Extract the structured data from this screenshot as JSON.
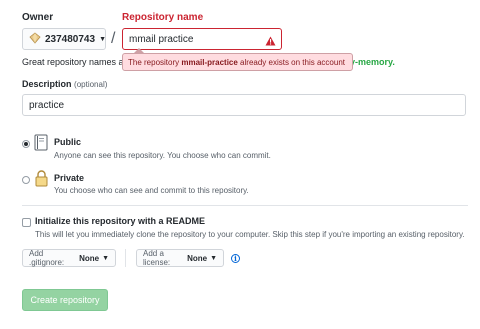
{
  "owner": {
    "label": "Owner",
    "name": "237480743"
  },
  "separator": "/",
  "repo": {
    "label": "Repository name",
    "value": "mmail practice",
    "error_prefix": "The repository ",
    "error_name": "mmail-practice",
    "error_suffix": " already exists on this account"
  },
  "hint": {
    "prefix": "Great repository names a",
    "suffix": "y-memory."
  },
  "description": {
    "label": "Description",
    "optional": "(optional)",
    "value": "practice"
  },
  "visibility": {
    "public": {
      "title": "Public",
      "desc": "Anyone can see this repository. You choose who can commit.",
      "selected": true
    },
    "private": {
      "title": "Private",
      "desc": "You choose who can see and commit to this repository.",
      "selected": false
    }
  },
  "init": {
    "title": "Initialize this repository with a README",
    "desc": "This will let you immediately clone the repository to your computer. Skip this step if you're importing an existing repository.",
    "checked": false
  },
  "gitignore": {
    "prefix": "Add .gitignore:",
    "value": "None"
  },
  "license": {
    "prefix": "Add a license:",
    "value": "None"
  },
  "create_label": "Create repository",
  "colors": {
    "error": "#cb2431",
    "create_bg": "#94d3a2",
    "link": "#0366d6"
  }
}
